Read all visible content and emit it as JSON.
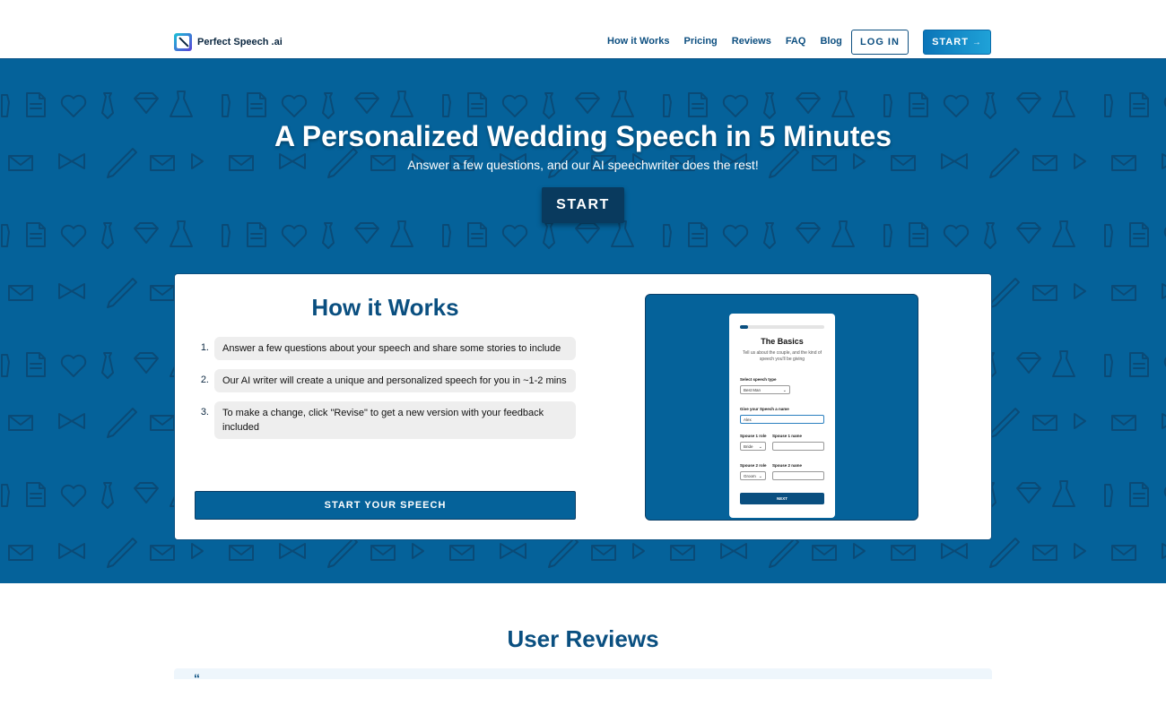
{
  "header": {
    "brand_name": "Perfect Speech .ai",
    "nav": [
      {
        "label": "How it Works"
      },
      {
        "label": "Pricing"
      },
      {
        "label": "Reviews"
      },
      {
        "label": "FAQ"
      },
      {
        "label": "Blog"
      }
    ],
    "login_label": "LOG IN",
    "start_label": "START",
    "start_arrow": "→"
  },
  "hero": {
    "title": "A Personalized Wedding Speech in 5 Minutes",
    "subtitle": "Answer a few questions, and our AI speechwriter does the rest!",
    "start_label": "START"
  },
  "how_it_works": {
    "title": "How it Works",
    "steps": [
      {
        "num": "1.",
        "text": "Answer a few questions about your speech and share some stories to include"
      },
      {
        "num": "2.",
        "text": "Our AI writer will create a unique and personalized speech for you in ~1-2 mins"
      },
      {
        "num": "3.",
        "text": "To make a change, click \"Revise\" to get a new version with your feedback included"
      }
    ],
    "cta_label": "START YOUR SPEECH",
    "preview": {
      "progress": 0.1,
      "title": "The Basics",
      "subtitle": "Tell us about the couple, and the kind of speech you'll be giving",
      "speech_type_label": "Select speech type",
      "speech_type_value": "Best Man",
      "name_label": "Give your Speech a name",
      "name_value": "Alex",
      "spouse1_role_label": "Spouse 1 role",
      "spouse1_role_value": "Bride",
      "spouse1_name_label": "Spouse 1 name",
      "spouse2_role_label": "Spouse 2 role",
      "spouse2_role_value": "Groom",
      "spouse2_name_label": "Spouse 2 name",
      "next_label": "NEXT"
    }
  },
  "reviews": {
    "title": "User Reviews",
    "quote_mark": "“"
  },
  "colors": {
    "hero_bg": "#05629a",
    "primary_dark": "#0a4f80",
    "accent_gradient_start": "#0b75b8",
    "accent_gradient_end": "#1fa2d8"
  }
}
